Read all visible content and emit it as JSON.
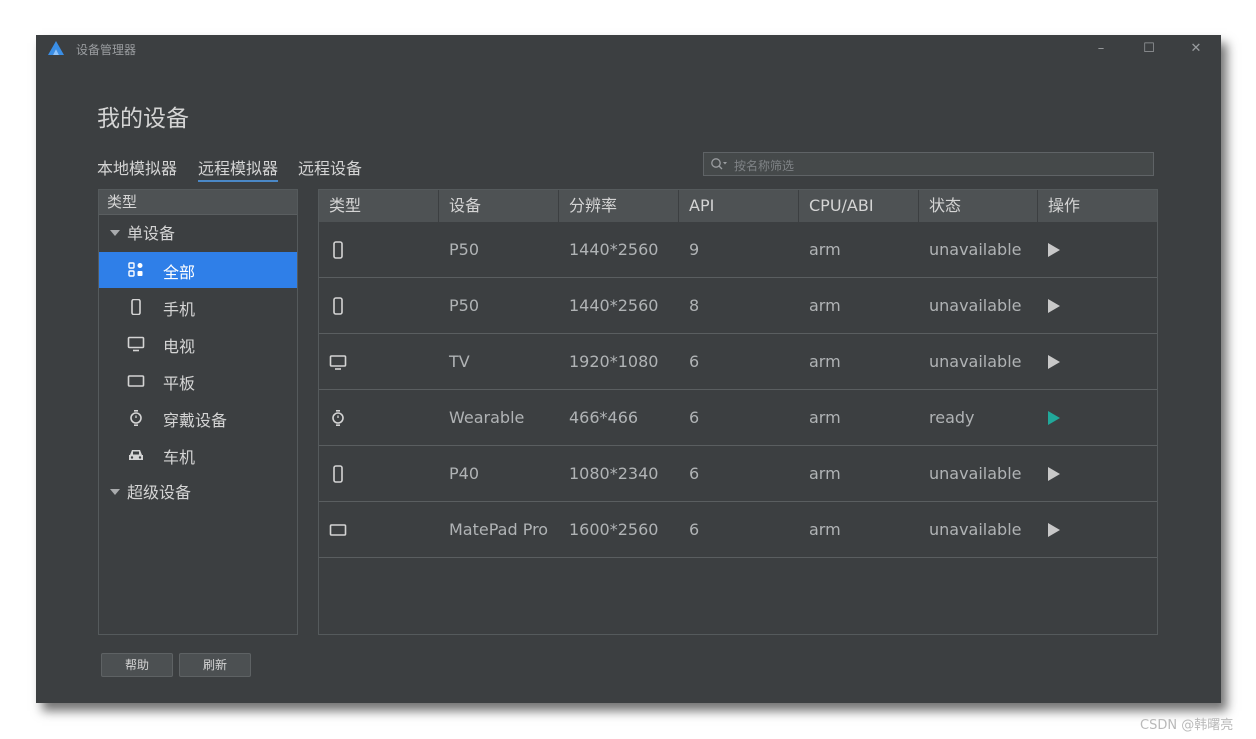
{
  "window": {
    "title": "设备管理器",
    "minimize": "–",
    "maximize": "☐",
    "close": "✕"
  },
  "page_title": "我的设备",
  "tabs": [
    {
      "label": "本地模拟器",
      "active": false
    },
    {
      "label": "远程模拟器",
      "active": true
    },
    {
      "label": "远程设备",
      "active": false
    }
  ],
  "search": {
    "placeholder": "按名称筛选"
  },
  "left_panel": {
    "header": "类型",
    "group_single": "单设备",
    "items": [
      {
        "label": "全部",
        "icon": "grid-icon",
        "selected": true
      },
      {
        "label": "手机",
        "icon": "phone-icon",
        "selected": false
      },
      {
        "label": "电视",
        "icon": "tv-icon",
        "selected": false
      },
      {
        "label": "平板",
        "icon": "tablet-icon",
        "selected": false
      },
      {
        "label": "穿戴设备",
        "icon": "watch-icon",
        "selected": false
      },
      {
        "label": "车机",
        "icon": "car-icon",
        "selected": false
      }
    ],
    "group_super": "超级设备"
  },
  "table": {
    "columns": [
      "类型",
      "设备",
      "分辨率",
      "API",
      "CPU/ABI",
      "状态",
      "操作"
    ],
    "rows": [
      {
        "icon": "phone-icon",
        "device": "P50",
        "resolution": "1440*2560",
        "api": "9",
        "abi": "arm",
        "status": "unavailable",
        "action_enabled": false
      },
      {
        "icon": "phone-icon",
        "device": "P50",
        "resolution": "1440*2560",
        "api": "8",
        "abi": "arm",
        "status": "unavailable",
        "action_enabled": false
      },
      {
        "icon": "tv-icon",
        "device": "TV",
        "resolution": "1920*1080",
        "api": "6",
        "abi": "arm",
        "status": "unavailable",
        "action_enabled": false
      },
      {
        "icon": "watch-icon",
        "device": "Wearable",
        "resolution": "466*466",
        "api": "6",
        "abi": "arm",
        "status": "ready",
        "action_enabled": true
      },
      {
        "icon": "phone-icon",
        "device": "P40",
        "resolution": "1080*2340",
        "api": "6",
        "abi": "arm",
        "status": "unavailable",
        "action_enabled": false
      },
      {
        "icon": "tablet-icon",
        "device": "MatePad Pro",
        "resolution": "1600*2560",
        "api": "6",
        "abi": "arm",
        "status": "unavailable",
        "action_enabled": false
      }
    ]
  },
  "buttons": {
    "help": "帮助",
    "refresh": "刷新"
  },
  "watermark": "CSDN @韩曙亮",
  "colors": {
    "accent": "#2f7fe8",
    "play_active": "#21a89a",
    "play_inactive": "#c8c8c8",
    "background": "#3c3f41"
  }
}
